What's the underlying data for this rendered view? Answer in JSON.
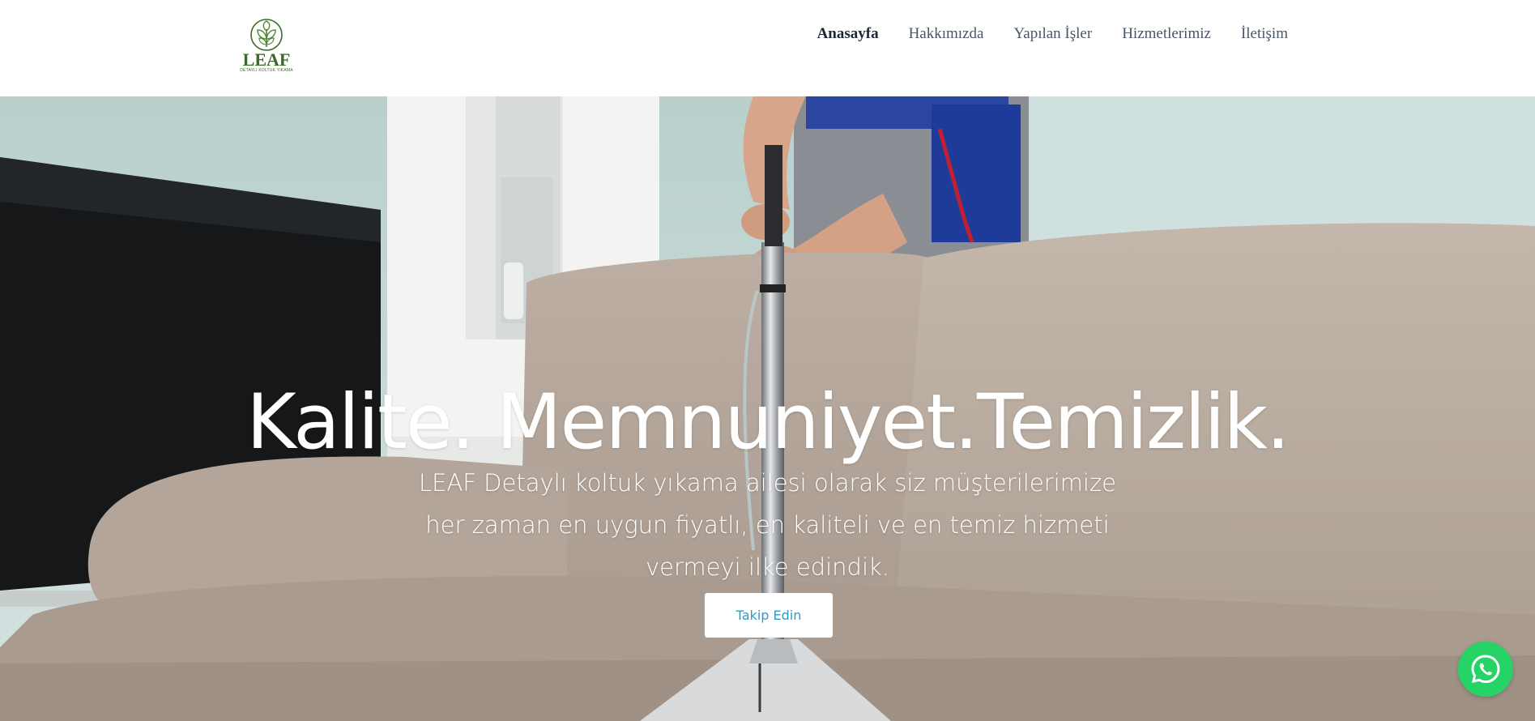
{
  "brand": {
    "logo_text": "LEAF",
    "logo_subtext": "DETAYLI KOLTUK YIKAMA",
    "logo_color": "#3a6b2a"
  },
  "nav": {
    "items": [
      {
        "label": "Anasayfa",
        "active": true
      },
      {
        "label": "Hakkımızda",
        "active": false
      },
      {
        "label": "Yapılan İşler",
        "active": false
      },
      {
        "label": "Hizmetlerimiz",
        "active": false
      },
      {
        "label": "İletişim",
        "active": false
      }
    ]
  },
  "hero": {
    "title": "Kalite. Memnuniyet.Temizlik.",
    "subtitle": "LEAF Detaylı koltuk yıkama ailesi olarak siz müşterilerimize her zaman en uygun fiyatlı, en kaliteli ve en temiz hizmeti vermeyi ilke edindik.",
    "cta_label": "Takip Edin",
    "cta_color": "#2c9bc8"
  },
  "widgets": {
    "whatsapp_icon": "whatsapp-icon",
    "whatsapp_color": "#25d366"
  }
}
